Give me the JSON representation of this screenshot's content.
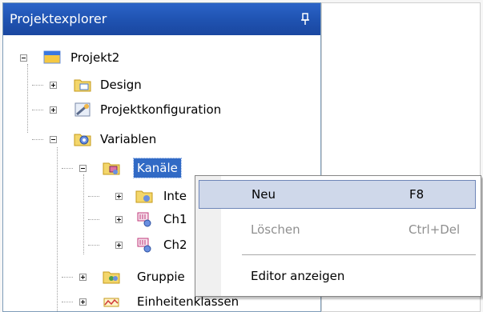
{
  "panel": {
    "title": "Projektexplorer"
  },
  "tree": {
    "root": "Projekt2",
    "design": "Design",
    "projektkonfiguration": "Projektkonfiguration",
    "variablen": "Variablen",
    "kanaele": "Kanäle",
    "child_inte": "Inte",
    "child_ch1": "Ch1",
    "child_ch2": "Ch2",
    "gruppie": "Gruppie",
    "einheitenklassen": "Einheitenklassen"
  },
  "context_menu": {
    "items": [
      {
        "label": "Neu",
        "shortcut": "F8"
      },
      {
        "label": "Löschen",
        "shortcut": "Ctrl+Del"
      },
      {
        "label": "Editor anzeigen",
        "shortcut": ""
      }
    ]
  },
  "colors": {
    "titlebar": "#1f52b0",
    "selection": "#316ac5",
    "menu_highlight": "#cfd8ea"
  }
}
